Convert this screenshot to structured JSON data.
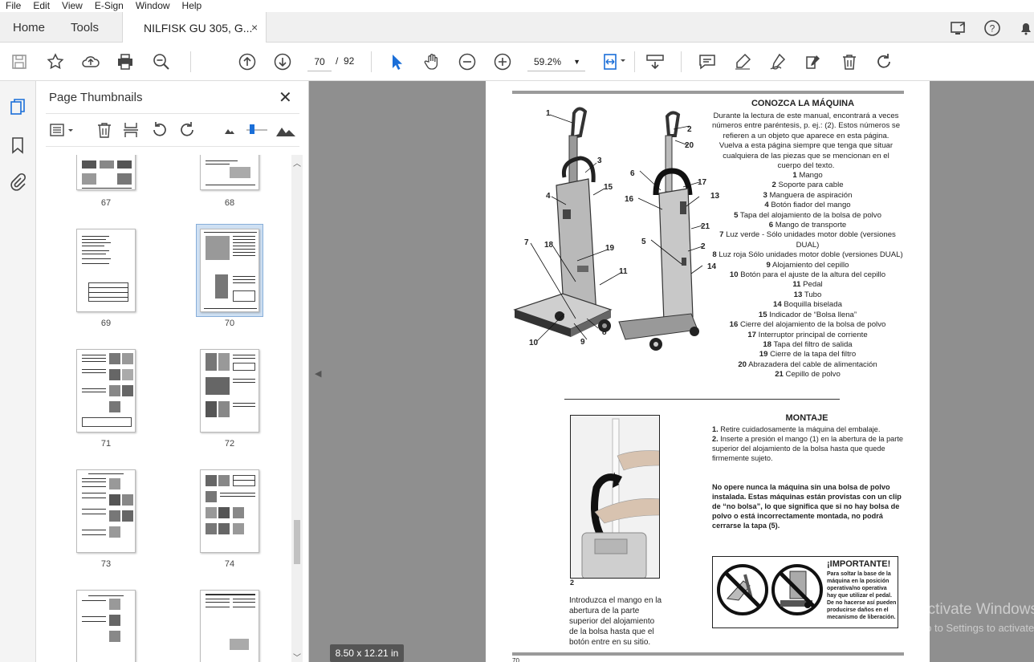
{
  "menubar": {
    "items": [
      "File",
      "Edit",
      "View",
      "E-Sign",
      "Window",
      "Help"
    ]
  },
  "tabs": {
    "home": "Home",
    "tools": "Tools",
    "document": "NILFISK GU 305, G...",
    "close": "×"
  },
  "toolbar": {
    "current_page": "70",
    "separator": "/",
    "total_pages": "92",
    "zoom": "59.2%",
    "zoom_caret": "▼"
  },
  "thumbnail_panel": {
    "title": "Page Thumbnails",
    "close": "✕",
    "pages": [
      "67",
      "68",
      "69",
      "70",
      "71",
      "72",
      "73",
      "74"
    ],
    "selected_page": "70"
  },
  "status": {
    "page_size": "8.50 x 12.21 in"
  },
  "watermark": {
    "line1": "Activate Windows",
    "line2": "Go to Settings to activate Windows."
  },
  "document": {
    "heading": "CONOZCA LA MÁQUINA",
    "intro": "Durante la lectura de este manual, encontrará a veces números entre paréntesis, p. ej.: (2). Estos números se refieren a un objeto que aparece en esta página. Vuelva a esta página siempre que tenga que situar cualquiera de las piezas que se mencionan en el cuerpo del texto.",
    "parts": [
      {
        "n": "1",
        "label": "Mango"
      },
      {
        "n": "2",
        "label": "Soporte para cable"
      },
      {
        "n": "3",
        "label": "Manguera de aspiración"
      },
      {
        "n": "4",
        "label": "Botón fiador del mango"
      },
      {
        "n": "5",
        "label": "Tapa del alojamiento de la bolsa de polvo"
      },
      {
        "n": "6",
        "label": "Mango de transporte"
      },
      {
        "n": "7",
        "label": "Luz verde - Sólo unidades motor doble (versiones DUAL)"
      },
      {
        "n": "8",
        "label": "Luz roja Sólo unidades motor doble (versiones DUAL)"
      },
      {
        "n": "9",
        "label": "Alojamiento del cepillo"
      },
      {
        "n": "10",
        "label": "Botón para el ajuste de la altura del cepillo"
      },
      {
        "n": "11",
        "label": "Pedal"
      },
      {
        "n": "13",
        "label": "Tubo"
      },
      {
        "n": "14",
        "label": "Boquilla biselada"
      },
      {
        "n": "15",
        "label": "Indicador de “Bolsa llena”"
      },
      {
        "n": "16",
        "label": "Cierre del alojamiento de la bolsa de polvo"
      },
      {
        "n": "17",
        "label": "Interruptor principal de corriente"
      },
      {
        "n": "18",
        "label": "Tapa del filtro de salida"
      },
      {
        "n": "19",
        "label": "Cierre de la tapa del filtro"
      },
      {
        "n": "20",
        "label": "Abrazadera del cable de alimentación"
      },
      {
        "n": "21",
        "label": "Cepillo de polvo"
      }
    ],
    "callouts_left": [
      "1",
      "3",
      "15",
      "4",
      "7",
      "18",
      "19",
      "11",
      "8",
      "10",
      "9"
    ],
    "callouts_right": [
      "2",
      "20",
      "6",
      "17",
      "13",
      "16",
      "21",
      "5",
      "2",
      "14"
    ],
    "montaje_heading": "MONTAJE",
    "step1_num": "1.",
    "step1": "Retire cuidadosamente la máquina del embalaje.",
    "step2_num": "2.",
    "step2": "Inserte a presión el mango (1) en la abertura de la parte superior del alojamiento de la bolsa hasta que quede firmemente sujeto.",
    "warning": "No opere nunca la máquina sin una bolsa de polvo instalada. Estas máquinas están provistas con un clip de “no bolsa”, lo que significa que si no hay bolsa de polvo o está incorrectamente montada, no podrá cerrarse la tapa (5).",
    "photo_label": "2",
    "photo_caption": "Introduzca el mango en la abertura de la parte superior del alojamiento de la bolsa hasta que el botón entre en su sitio.",
    "importante_title": "¡IMPORTANTE!",
    "importante_text": "Para soltar la base de la máquina en la posición operativa/no operativa hay que utilizar el pedal. De no hacerse así pueden producirse daños en el mecanismo de liberación.",
    "footer_page": "70"
  }
}
